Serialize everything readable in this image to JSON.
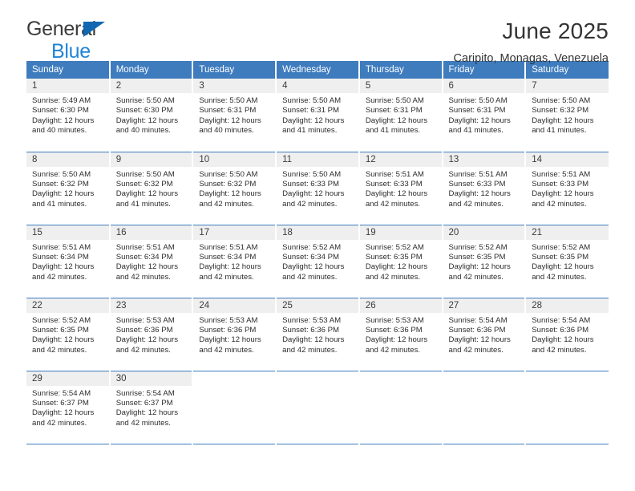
{
  "brand": {
    "line1": "General",
    "line2": "Blue",
    "triangle_color": "#1167b1",
    "blue_text_color": "#1f84d6"
  },
  "header": {
    "title": "June 2025",
    "subtitle": "Caripito, Monagas, Venezuela"
  },
  "theme": {
    "header_blue": "#3e7cbe",
    "daynum_bg": "#efefef",
    "text": "#2d2d2d"
  },
  "calendar": {
    "weekday_headers": [
      "Sunday",
      "Monday",
      "Tuesday",
      "Wednesday",
      "Thursday",
      "Friday",
      "Saturday"
    ],
    "weeks": [
      [
        {
          "day": "1",
          "sunrise": "Sunrise: 5:49 AM",
          "sunset": "Sunset: 6:30 PM",
          "daylight1": "Daylight: 12 hours",
          "daylight2": "and 40 minutes."
        },
        {
          "day": "2",
          "sunrise": "Sunrise: 5:50 AM",
          "sunset": "Sunset: 6:30 PM",
          "daylight1": "Daylight: 12 hours",
          "daylight2": "and 40 minutes."
        },
        {
          "day": "3",
          "sunrise": "Sunrise: 5:50 AM",
          "sunset": "Sunset: 6:31 PM",
          "daylight1": "Daylight: 12 hours",
          "daylight2": "and 40 minutes."
        },
        {
          "day": "4",
          "sunrise": "Sunrise: 5:50 AM",
          "sunset": "Sunset: 6:31 PM",
          "daylight1": "Daylight: 12 hours",
          "daylight2": "and 41 minutes."
        },
        {
          "day": "5",
          "sunrise": "Sunrise: 5:50 AM",
          "sunset": "Sunset: 6:31 PM",
          "daylight1": "Daylight: 12 hours",
          "daylight2": "and 41 minutes."
        },
        {
          "day": "6",
          "sunrise": "Sunrise: 5:50 AM",
          "sunset": "Sunset: 6:31 PM",
          "daylight1": "Daylight: 12 hours",
          "daylight2": "and 41 minutes."
        },
        {
          "day": "7",
          "sunrise": "Sunrise: 5:50 AM",
          "sunset": "Sunset: 6:32 PM",
          "daylight1": "Daylight: 12 hours",
          "daylight2": "and 41 minutes."
        }
      ],
      [
        {
          "day": "8",
          "sunrise": "Sunrise: 5:50 AM",
          "sunset": "Sunset: 6:32 PM",
          "daylight1": "Daylight: 12 hours",
          "daylight2": "and 41 minutes."
        },
        {
          "day": "9",
          "sunrise": "Sunrise: 5:50 AM",
          "sunset": "Sunset: 6:32 PM",
          "daylight1": "Daylight: 12 hours",
          "daylight2": "and 41 minutes."
        },
        {
          "day": "10",
          "sunrise": "Sunrise: 5:50 AM",
          "sunset": "Sunset: 6:32 PM",
          "daylight1": "Daylight: 12 hours",
          "daylight2": "and 42 minutes."
        },
        {
          "day": "11",
          "sunrise": "Sunrise: 5:50 AM",
          "sunset": "Sunset: 6:33 PM",
          "daylight1": "Daylight: 12 hours",
          "daylight2": "and 42 minutes."
        },
        {
          "day": "12",
          "sunrise": "Sunrise: 5:51 AM",
          "sunset": "Sunset: 6:33 PM",
          "daylight1": "Daylight: 12 hours",
          "daylight2": "and 42 minutes."
        },
        {
          "day": "13",
          "sunrise": "Sunrise: 5:51 AM",
          "sunset": "Sunset: 6:33 PM",
          "daylight1": "Daylight: 12 hours",
          "daylight2": "and 42 minutes."
        },
        {
          "day": "14",
          "sunrise": "Sunrise: 5:51 AM",
          "sunset": "Sunset: 6:33 PM",
          "daylight1": "Daylight: 12 hours",
          "daylight2": "and 42 minutes."
        }
      ],
      [
        {
          "day": "15",
          "sunrise": "Sunrise: 5:51 AM",
          "sunset": "Sunset: 6:34 PM",
          "daylight1": "Daylight: 12 hours",
          "daylight2": "and 42 minutes."
        },
        {
          "day": "16",
          "sunrise": "Sunrise: 5:51 AM",
          "sunset": "Sunset: 6:34 PM",
          "daylight1": "Daylight: 12 hours",
          "daylight2": "and 42 minutes."
        },
        {
          "day": "17",
          "sunrise": "Sunrise: 5:51 AM",
          "sunset": "Sunset: 6:34 PM",
          "daylight1": "Daylight: 12 hours",
          "daylight2": "and 42 minutes."
        },
        {
          "day": "18",
          "sunrise": "Sunrise: 5:52 AM",
          "sunset": "Sunset: 6:34 PM",
          "daylight1": "Daylight: 12 hours",
          "daylight2": "and 42 minutes."
        },
        {
          "day": "19",
          "sunrise": "Sunrise: 5:52 AM",
          "sunset": "Sunset: 6:35 PM",
          "daylight1": "Daylight: 12 hours",
          "daylight2": "and 42 minutes."
        },
        {
          "day": "20",
          "sunrise": "Sunrise: 5:52 AM",
          "sunset": "Sunset: 6:35 PM",
          "daylight1": "Daylight: 12 hours",
          "daylight2": "and 42 minutes."
        },
        {
          "day": "21",
          "sunrise": "Sunrise: 5:52 AM",
          "sunset": "Sunset: 6:35 PM",
          "daylight1": "Daylight: 12 hours",
          "daylight2": "and 42 minutes."
        }
      ],
      [
        {
          "day": "22",
          "sunrise": "Sunrise: 5:52 AM",
          "sunset": "Sunset: 6:35 PM",
          "daylight1": "Daylight: 12 hours",
          "daylight2": "and 42 minutes."
        },
        {
          "day": "23",
          "sunrise": "Sunrise: 5:53 AM",
          "sunset": "Sunset: 6:36 PM",
          "daylight1": "Daylight: 12 hours",
          "daylight2": "and 42 minutes."
        },
        {
          "day": "24",
          "sunrise": "Sunrise: 5:53 AM",
          "sunset": "Sunset: 6:36 PM",
          "daylight1": "Daylight: 12 hours",
          "daylight2": "and 42 minutes."
        },
        {
          "day": "25",
          "sunrise": "Sunrise: 5:53 AM",
          "sunset": "Sunset: 6:36 PM",
          "daylight1": "Daylight: 12 hours",
          "daylight2": "and 42 minutes."
        },
        {
          "day": "26",
          "sunrise": "Sunrise: 5:53 AM",
          "sunset": "Sunset: 6:36 PM",
          "daylight1": "Daylight: 12 hours",
          "daylight2": "and 42 minutes."
        },
        {
          "day": "27",
          "sunrise": "Sunrise: 5:54 AM",
          "sunset": "Sunset: 6:36 PM",
          "daylight1": "Daylight: 12 hours",
          "daylight2": "and 42 minutes."
        },
        {
          "day": "28",
          "sunrise": "Sunrise: 5:54 AM",
          "sunset": "Sunset: 6:36 PM",
          "daylight1": "Daylight: 12 hours",
          "daylight2": "and 42 minutes."
        }
      ],
      [
        {
          "day": "29",
          "sunrise": "Sunrise: 5:54 AM",
          "sunset": "Sunset: 6:37 PM",
          "daylight1": "Daylight: 12 hours",
          "daylight2": "and 42 minutes."
        },
        {
          "day": "30",
          "sunrise": "Sunrise: 5:54 AM",
          "sunset": "Sunset: 6:37 PM",
          "daylight1": "Daylight: 12 hours",
          "daylight2": "and 42 minutes."
        },
        {
          "day": "",
          "sunrise": "",
          "sunset": "",
          "daylight1": "",
          "daylight2": ""
        },
        {
          "day": "",
          "sunrise": "",
          "sunset": "",
          "daylight1": "",
          "daylight2": ""
        },
        {
          "day": "",
          "sunrise": "",
          "sunset": "",
          "daylight1": "",
          "daylight2": ""
        },
        {
          "day": "",
          "sunrise": "",
          "sunset": "",
          "daylight1": "",
          "daylight2": ""
        },
        {
          "day": "",
          "sunrise": "",
          "sunset": "",
          "daylight1": "",
          "daylight2": ""
        }
      ]
    ]
  }
}
